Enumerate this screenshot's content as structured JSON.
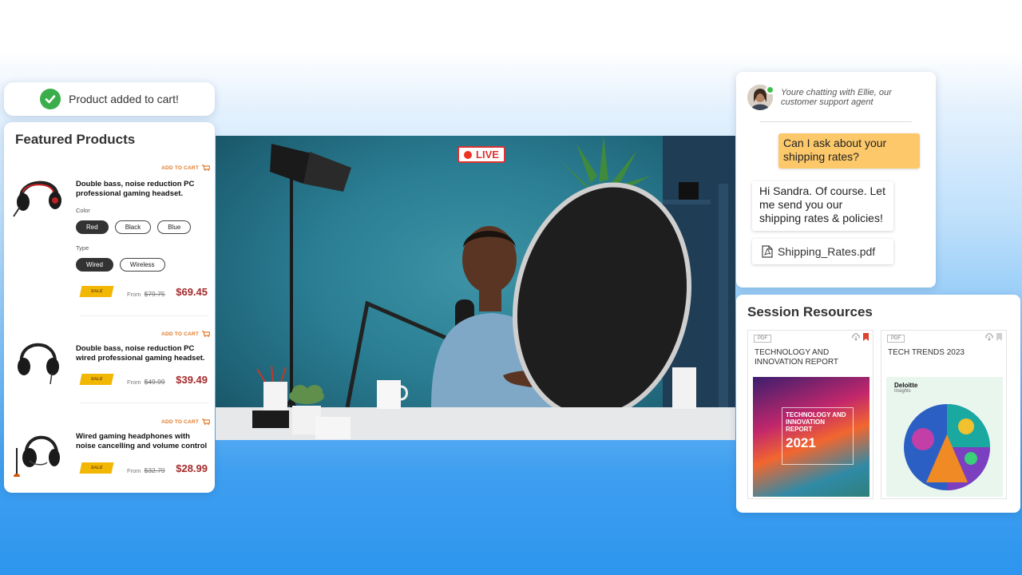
{
  "toast": {
    "message": "Product added to cart!"
  },
  "featured": {
    "title": "Featured Products",
    "products": [
      {
        "add_to_cart": "ADD TO CART",
        "title": "Double bass, noise reduction PC professional gaming headset.",
        "color_label": "Color",
        "colors": [
          "Red",
          "Black",
          "Blue"
        ],
        "type_label": "Type",
        "types": [
          "Wired",
          "Wireless"
        ],
        "sale": "SALE",
        "from": "From",
        "old_price": "$79.75",
        "price": "$69.45"
      },
      {
        "add_to_cart": "ADD TO CART",
        "title": "Double bass, noise reduction PC wired professional gaming headset.",
        "sale": "SALE",
        "from": "From",
        "old_price": "$49.99",
        "price": "$39.49"
      },
      {
        "add_to_cart": "ADD TO CART",
        "title": "Wired gaming headphones with noise cancelling and volume control",
        "sale": "SALE",
        "from": "From",
        "old_price": "$32.79",
        "price": "$28.99"
      }
    ]
  },
  "live": {
    "label": "LIVE"
  },
  "chat": {
    "header": "Youre chatting with Ellie, our customer support agent",
    "messages": {
      "user": "Can I ask about your shipping rates?",
      "agent": "Hi Sandra. Of course. Let me send you our shipping rates & policies!"
    },
    "attachment": "Shipping_Rates.pdf"
  },
  "resources": {
    "title": "Session Resources",
    "items": [
      {
        "badge": "PDF",
        "title": "TECHNOLOGY AND INNOVATION REPORT",
        "cover_text": "TECHNOLOGY AND INNOVATION REPORT",
        "cover_year": "2021"
      },
      {
        "badge": "PDF",
        "title": "TECH TRENDS 2023",
        "cover_brand": "Deloitte",
        "cover_sub": "Insights"
      }
    ]
  },
  "colors": {
    "accent_orange": "#e07a2a",
    "price_red": "#a52a2a",
    "live_red": "#dd3322",
    "chat_yellow": "#fcc86a",
    "success_green": "#3bae4b"
  }
}
